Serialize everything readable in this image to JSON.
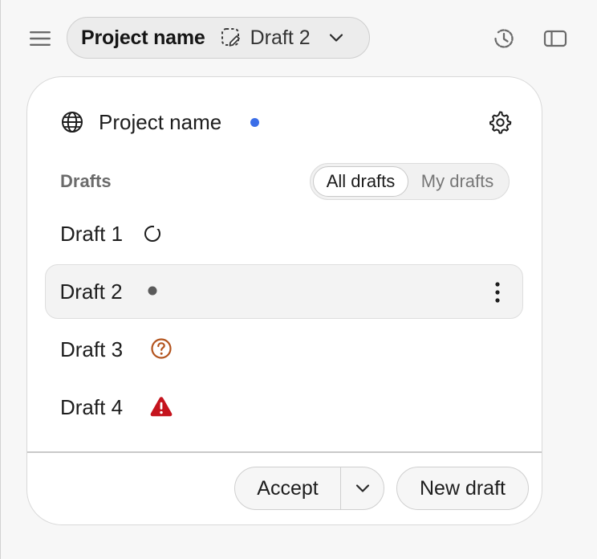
{
  "toolbar": {
    "menu_icon": "hamburger-menu-icon",
    "project_name": "Project name",
    "draft_icon": "dashed-draft-icon",
    "current_draft": "Draft 2",
    "chevron_icon": "chevron-down-icon",
    "history_icon": "history-clock-icon",
    "sidebar_icon": "sidebar-panel-icon"
  },
  "panel": {
    "globe_icon": "globe-icon",
    "title": "Project name",
    "unsaved_dot_color": "#3b6ee8",
    "settings_icon": "gear-icon",
    "section_label": "Drafts",
    "filter": {
      "options": [
        "All drafts",
        "My drafts"
      ],
      "selected": "All drafts"
    },
    "drafts": [
      {
        "name": "Draft 1",
        "status": "loading",
        "status_icon": "loading-circle-icon"
      },
      {
        "name": "Draft 2",
        "status": "current",
        "status_icon": "gray-dot-icon",
        "selected": true,
        "more_icon": "more-vertical-icon"
      },
      {
        "name": "Draft 3",
        "status": "unknown",
        "status_icon": "question-circle-icon",
        "status_color": "#b3541e"
      },
      {
        "name": "Draft 4",
        "status": "error",
        "status_icon": "warning-triangle-icon",
        "status_color": "#c5141e"
      }
    ],
    "footer": {
      "accept_label": "Accept",
      "accept_menu_icon": "chevron-down-icon",
      "new_draft_label": "New draft"
    }
  }
}
